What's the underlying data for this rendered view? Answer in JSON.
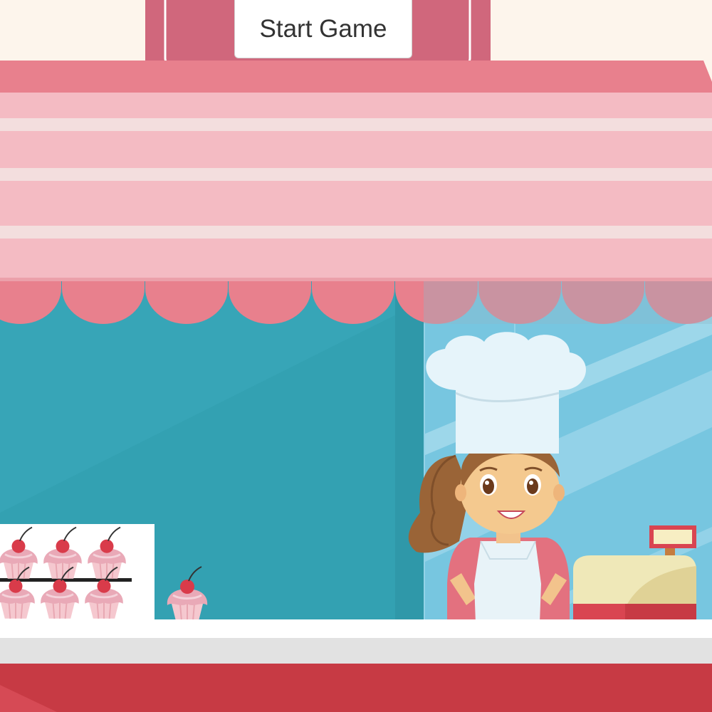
{
  "menu": {
    "start_label": "Start Game"
  },
  "scene": {
    "character": "baker-girl",
    "items": [
      "cupcake-display-case",
      "cupcake",
      "cash-register",
      "chef-hat",
      "shop-awning"
    ]
  },
  "colors": {
    "background": "#fdf5ec",
    "awning_dark": "#e8808d",
    "awning_light": "#f4bbc3",
    "awning_stripe": "#f3dede",
    "window_teal": "#33a1b2",
    "glass_blue": "#77c6e0",
    "counter_red": "#c73a44",
    "register_cream": "#efe8b8",
    "sign_pink": "#d0677c"
  }
}
